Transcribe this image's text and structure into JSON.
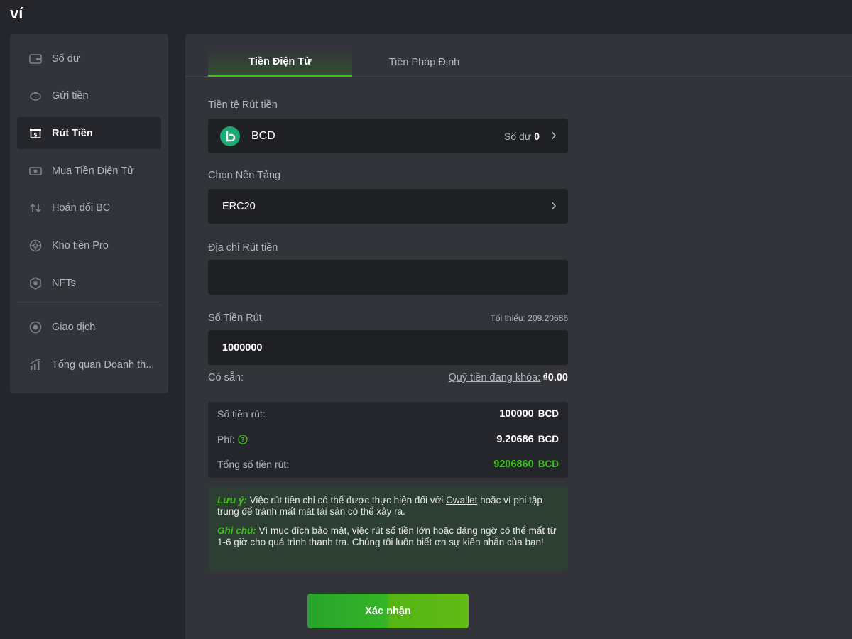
{
  "page": {
    "title": "ví"
  },
  "sidebar": {
    "items": [
      {
        "label": "Số dư",
        "icon": "wallet-icon",
        "active": false
      },
      {
        "label": "Gửi tiền",
        "icon": "piggy-bank-icon",
        "active": false
      },
      {
        "label": "Rút Tiền",
        "icon": "withdraw-icon",
        "active": true
      },
      {
        "label": "Mua Tiền Điện Tử",
        "icon": "cash-icon",
        "active": false
      },
      {
        "label": "Hoán đổi BC",
        "icon": "swap-icon",
        "active": false
      },
      {
        "label": "Kho tiền Pro",
        "icon": "vault-icon",
        "active": false
      },
      {
        "label": "NFTs",
        "icon": "nft-icon",
        "active": false
      },
      {
        "label": "Giao dịch",
        "icon": "transaction-icon",
        "active": false
      },
      {
        "label": "Tổng quan Doanh th...",
        "icon": "chart-icon",
        "active": false
      }
    ]
  },
  "tabs": [
    {
      "label": "Tiền Điện Tử",
      "active": true
    },
    {
      "label": "Tiền Pháp Định",
      "active": false
    }
  ],
  "currency": {
    "label": "Tiền tệ Rút tiền",
    "coin": "BCD",
    "balance_label": "Số dư",
    "balance_value": "0"
  },
  "network": {
    "label": "Chọn Nền Tảng",
    "value": "ERC20"
  },
  "address": {
    "label": "Địa chỉ Rút tiền",
    "value": ""
  },
  "amount": {
    "label": "Số Tiền Rút",
    "min_note": "Tối thiểu: 209.20686",
    "value": "1000000"
  },
  "available": {
    "label": "Có sẵn:",
    "locked_label": "Quỹ tiền đang khóa:",
    "locked_value": "₫0.00"
  },
  "summary": {
    "withdraw_label": "Số tiền rút:",
    "withdraw_value": "100000",
    "withdraw_cur": "BCD",
    "fee_label": "Phí:",
    "fee_value": "9.20686",
    "fee_cur": "BCD",
    "total_label": "Tổng số tiền rút:",
    "total_value": "9206860",
    "total_cur": "BCD"
  },
  "notice": {
    "note1_title": "Lưu ý:",
    "note1_pre": " Việc rút tiền chỉ có thể được thực hiện đối với ",
    "note1_link": "Cwallet",
    "note1_post": " hoặc ví phi tập trung để tránh mất mát tài sản có thể xảy ra.",
    "note2_title": "Ghi chú:",
    "note2_text": " Vì mục đích bảo mật, việc rút số tiền lớn hoặc đáng ngờ có thể mất từ 1-6 giờ cho quá trình thanh tra. Chúng tôi luôn biết ơn sự kiên nhẫn của bạn!"
  },
  "confirm": {
    "label": "Xác nhận"
  },
  "colors": {
    "accent": "#3bc117",
    "panel": "#323439",
    "field": "#1e2024",
    "notice_bg": "#2c3f32"
  }
}
